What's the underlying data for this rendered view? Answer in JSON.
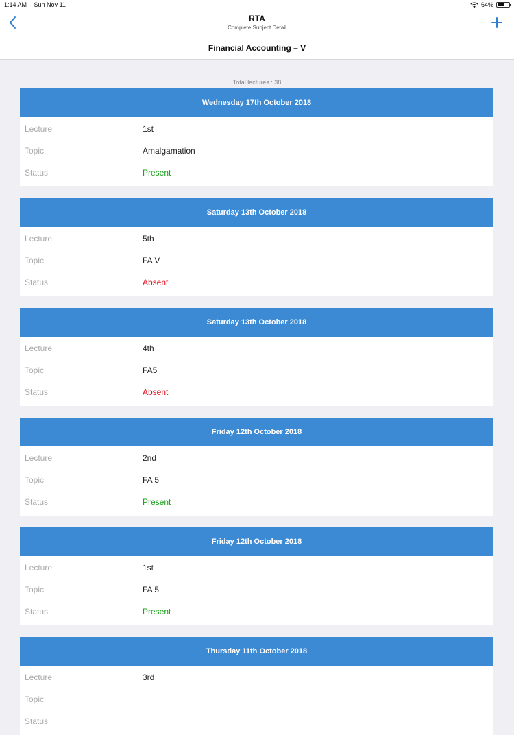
{
  "status_bar": {
    "time": "1:14 AM",
    "date": "Sun Nov 11",
    "battery": "64%",
    "battery_level": 0.64
  },
  "nav": {
    "title": "RTA",
    "subtitle": "Complete Subject Detail"
  },
  "subject": {
    "name": "Financial Accounting – V"
  },
  "summary": {
    "total_label": "Total lectures : 38"
  },
  "labels": {
    "lecture": "Lecture",
    "topic": "Topic",
    "status": "Status"
  },
  "colors": {
    "header": "#3d8ad4",
    "present": "#1aa11a",
    "absent": "#e0101f",
    "accent": "#2f7fd0"
  },
  "lectures": [
    {
      "date": "Wednesday 17th October 2018",
      "lecture": "1st",
      "topic": "Amalgamation",
      "status": "Present"
    },
    {
      "date": "Saturday 13th October 2018",
      "lecture": "5th",
      "topic": "FA V",
      "status": "Absent"
    },
    {
      "date": "Saturday 13th October 2018",
      "lecture": "4th",
      "topic": "FA5",
      "status": "Absent"
    },
    {
      "date": "Friday 12th October 2018",
      "lecture": "2nd",
      "topic": "FA 5",
      "status": "Present"
    },
    {
      "date": "Friday 12th October 2018",
      "lecture": "1st",
      "topic": "FA 5",
      "status": "Present"
    },
    {
      "date": "Thursday 11th October 2018",
      "lecture": "3rd",
      "topic": "",
      "status": ""
    }
  ]
}
